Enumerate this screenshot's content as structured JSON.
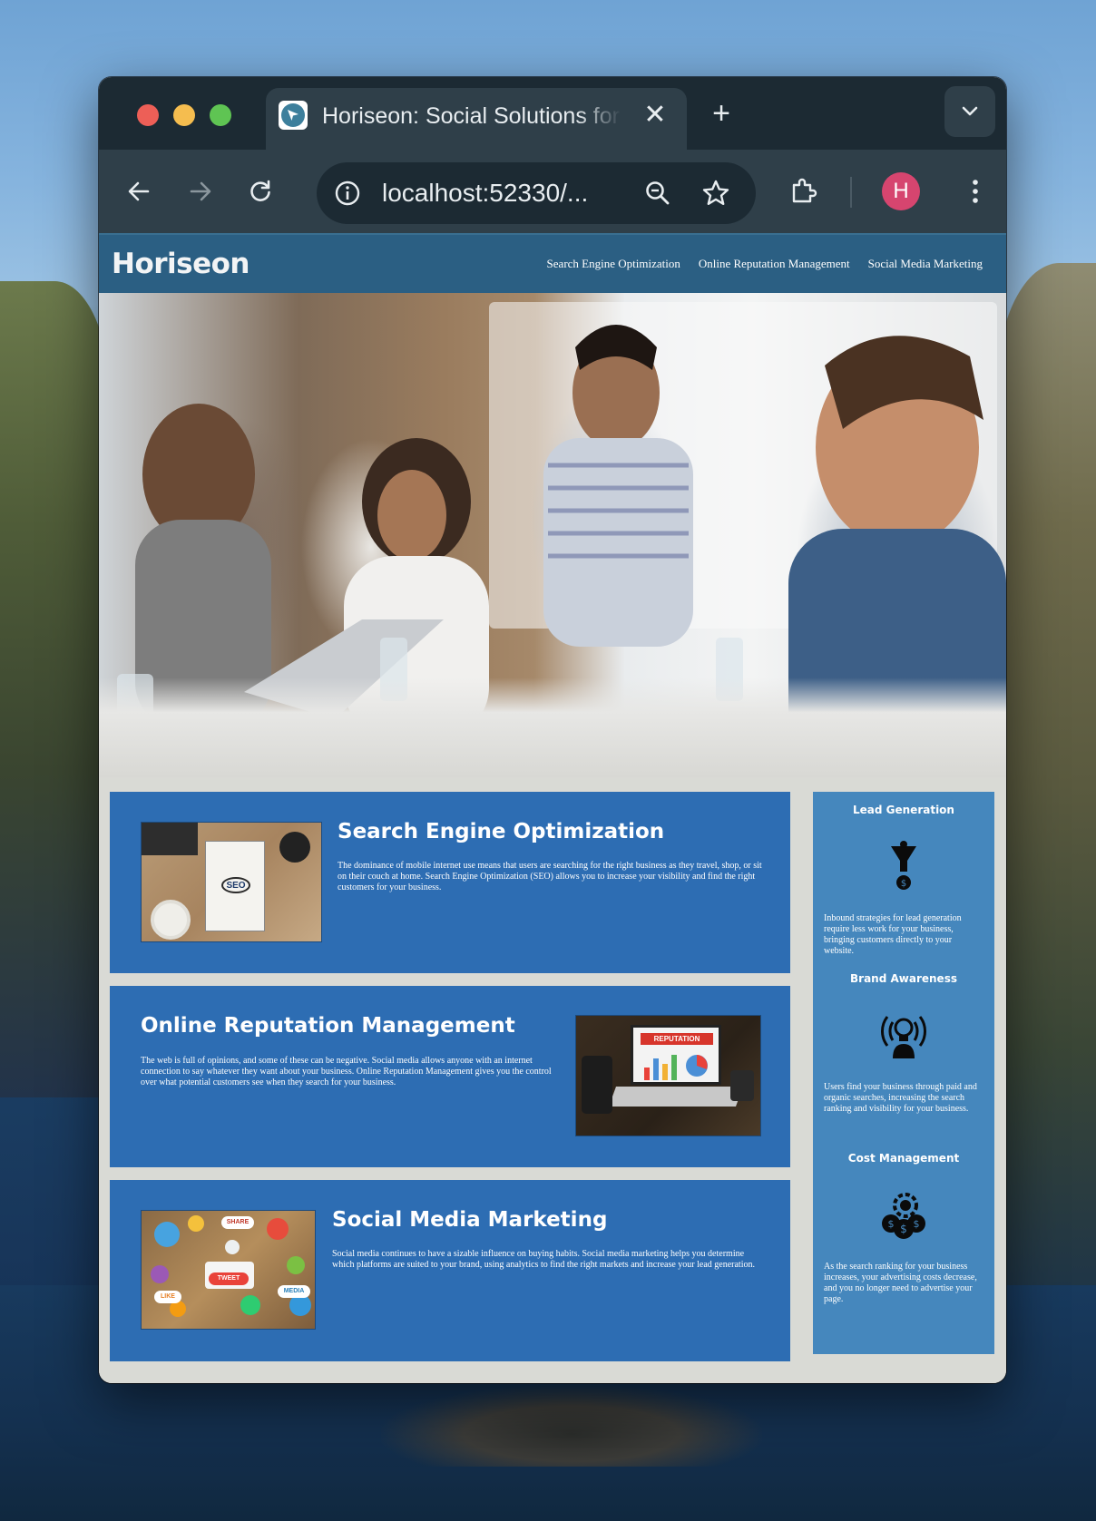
{
  "browser": {
    "tab_title": "Horiseon: Social Solutions for Innovative Businesses",
    "tab_close": "✕",
    "new_tab": "+",
    "url": "localhost:52330/...",
    "profile_initial": "H"
  },
  "site": {
    "logo": "Horiseon",
    "nav": [
      "Search Engine Optimization",
      "Online Reputation Management",
      "Social Media Marketing"
    ],
    "hero_alt": "team meeting around a table"
  },
  "content": [
    {
      "title": "Search Engine Optimization",
      "text": "The dominance of mobile internet use means that users are searching for the right business as they travel, shop, or sit on their couch at home. Search Engine Optimization (SEO) allows you to increase your visibility and find the right customers for your business."
    },
    {
      "title": "Online Reputation Management",
      "text": "The web is full of opinions, and some of these can be negative. Social media allows anyone with an internet connection to say whatever they want about your business. Online Reputation Management gives you the control over what potential customers see when they search for your business."
    },
    {
      "title": "Social Media Marketing",
      "text": "Social media continues to have a sizable influence on buying habits. Social media marketing helps you determine which platforms are suited to your brand, using analytics to find the right markets and increase your lead generation."
    }
  ],
  "image_labels": {
    "seo": "SEO",
    "reputation": "REPUTATION",
    "social_words": [
      "SHARE",
      "TWEET",
      "LIKE",
      "MEDIA"
    ]
  },
  "benefits": [
    {
      "title": "Lead Generation",
      "icon": "lead-generation-icon",
      "text": "Inbound strategies for lead generation require less work for your business, bringing customers directly to your website."
    },
    {
      "title": "Brand Awareness",
      "icon": "brand-awareness-icon",
      "text": "Users find your business through paid and organic searches, increasing the search ranking and visibility for your business."
    },
    {
      "title": "Cost Management",
      "icon": "cost-management-icon",
      "text": "As the search ranking for your business increases, your advertising costs decrease, and you no longer need to advertise your page."
    }
  ],
  "colors": {
    "header": "#2b5f83",
    "card": "#2d6db3",
    "sidebar": "#4587bd",
    "page_bg": "#d9dad5",
    "avatar": "#d6456f"
  }
}
